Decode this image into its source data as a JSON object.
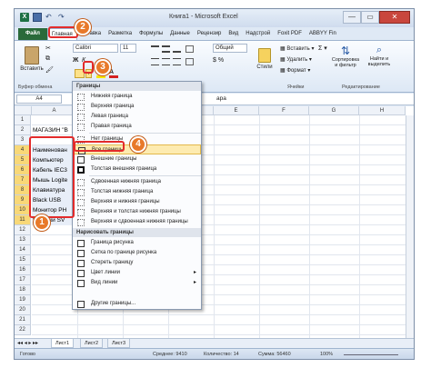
{
  "window": {
    "title": "Книга1 - Microsoft Excel",
    "logo": "X",
    "buttons": [
      "—",
      "▭",
      "✕"
    ]
  },
  "tabs": [
    "Файл",
    "Главная",
    "Вставка",
    "Разметка",
    "Формулы",
    "Данные",
    "Рецензир",
    "Вид",
    "Надстрой",
    "Foxit PDF",
    "ABBYY Fin"
  ],
  "ribbon": {
    "paste": "Вставить",
    "clipboard_group": "Буфер обмена",
    "font_name": "Calibri",
    "font_size": "11",
    "number_format": "Общий",
    "insert": "Вставить",
    "delete": "Удалить",
    "format": "Формат",
    "cells_group": "Ячейки",
    "sort": "Сортировка",
    "sort2": "и фильтр",
    "find": "Найти и",
    "find2": "выделить",
    "edit_group": "Редактирование",
    "styles": "Стили"
  },
  "formula_bar": {
    "namebox": "A4",
    "content": "ара"
  },
  "columns": [
    "A",
    "B",
    "C",
    "D",
    "E",
    "F",
    "G",
    "H"
  ],
  "rows": [
    {
      "num": "1",
      "text": ""
    },
    {
      "num": "2",
      "text": "МАГАЗИН \"В"
    },
    {
      "num": "3",
      "text": ""
    },
    {
      "num": "4",
      "text": "Наименован"
    },
    {
      "num": "5",
      "text": "Компьютер"
    },
    {
      "num": "6",
      "text": "Кабель IEC3"
    },
    {
      "num": "7",
      "text": "Мышь Logite"
    },
    {
      "num": "8",
      "text": "Клавиатура"
    },
    {
      "num": "9",
      "text": "Black USB"
    },
    {
      "num": "10",
      "text": "Монитор PH"
    },
    {
      "num": "11",
      "text": "Колонки SV"
    },
    {
      "num": "12",
      "text": ""
    },
    {
      "num": "13",
      "text": ""
    },
    {
      "num": "14",
      "text": ""
    },
    {
      "num": "15",
      "text": ""
    },
    {
      "num": "16",
      "text": ""
    },
    {
      "num": "17",
      "text": ""
    },
    {
      "num": "18",
      "text": ""
    },
    {
      "num": "19",
      "text": ""
    },
    {
      "num": "20",
      "text": ""
    },
    {
      "num": "21",
      "text": ""
    },
    {
      "num": "22",
      "text": ""
    }
  ],
  "menu": {
    "header1": "Границы",
    "items1": [
      "Нижняя граница",
      "Верхняя граница",
      "Левая граница",
      "Правая граница"
    ],
    "items2": [
      "Нет границы",
      "Все границы",
      "Внешние границы",
      "Толстая внешняя граница"
    ],
    "items3": [
      "Сдвоенная нижняя граница",
      "Толстая нижняя граница",
      "Верхняя и нижняя границы",
      "Верхняя и толстая нижняя границы",
      "Верхняя и сдвоенная нижняя границы"
    ],
    "header2": "Нарисовать границы",
    "items4": [
      "Граница рисунка",
      "Сетка по границе рисунка",
      "Стереть границу",
      "Цвет линии",
      "Вид линии"
    ],
    "more": "Другие границы..."
  },
  "badges": [
    "1",
    "2",
    "3",
    "4"
  ],
  "sheets": [
    "Лист1",
    "Лист2",
    "Лист3"
  ],
  "status": {
    "ready": "Готово",
    "average": "Среднее: 9410",
    "count": "Количество: 14",
    "sum": "Сумма: 56460",
    "zoom": "100%"
  }
}
